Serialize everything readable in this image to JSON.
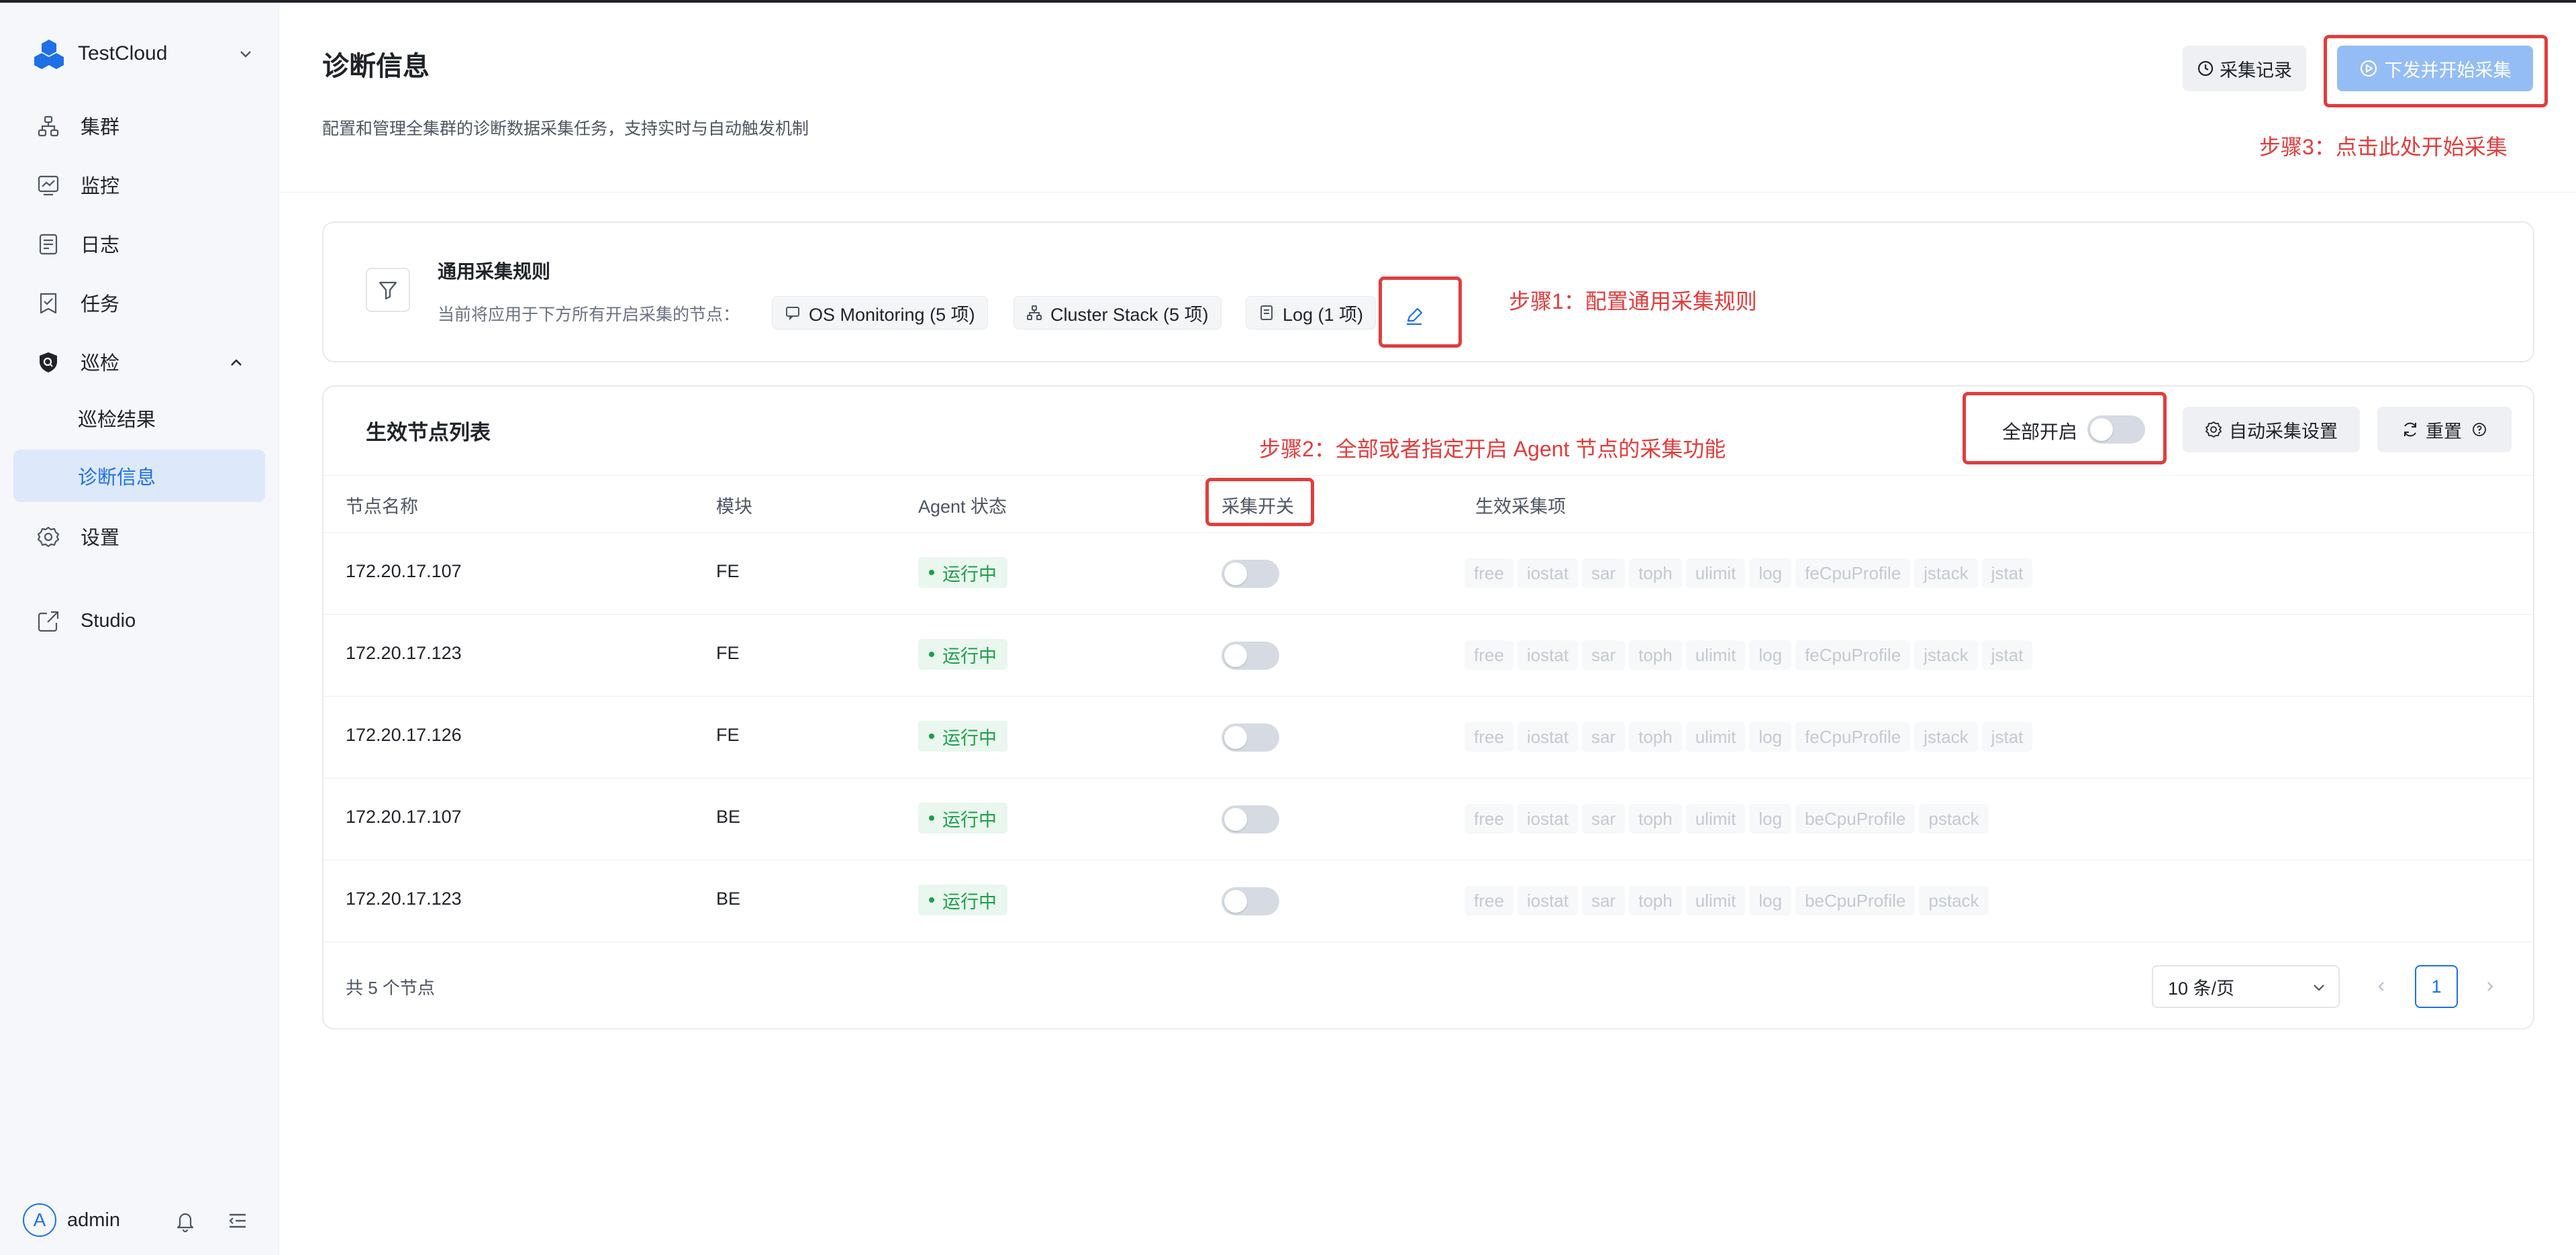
{
  "app": {
    "name": "TestCloud"
  },
  "sidebar": {
    "items": [
      {
        "label": "集群",
        "icon": "cluster-icon"
      },
      {
        "label": "监控",
        "icon": "monitor-icon"
      },
      {
        "label": "日志",
        "icon": "log-icon"
      },
      {
        "label": "任务",
        "icon": "task-icon"
      },
      {
        "label": "巡检",
        "icon": "shield-icon"
      },
      {
        "label": "设置",
        "icon": "gear-icon"
      },
      {
        "label": "Studio",
        "icon": "external-link-icon"
      }
    ],
    "sub_items": [
      {
        "label": "巡检结果"
      },
      {
        "label": "诊断信息",
        "active": true
      }
    ],
    "user": {
      "avatar": "A",
      "name": "admin"
    }
  },
  "header": {
    "title": "诊断信息",
    "description": "配置和管理全集群的诊断数据采集任务，支持实时与自动触发机制",
    "records_button": "采集记录",
    "start_button": "下发并开始采集"
  },
  "annotations": {
    "step1": "步骤1：配置通用采集规则",
    "step2": "步骤2：全部或者指定开启 Agent 节点的采集功能",
    "step3": "步骤3：点击此处开始采集",
    "color": "#e23c3c"
  },
  "rules": {
    "title": "通用采集规则",
    "description": "当前将应用于下方所有开启采集的节点：",
    "tags": [
      "OS Monitoring (5 项)",
      "Cluster Stack (5 项)",
      "Log (1 项)"
    ]
  },
  "node_list": {
    "title": "生效节点列表",
    "enable_all_label": "全部开启",
    "auto_button": "自动采集设置",
    "reset_button": "重置",
    "columns": [
      "节点名称",
      "模块",
      "Agent 状态",
      "采集开关",
      "生效采集项"
    ],
    "rows": [
      {
        "node": "172.20.17.107",
        "module": "FE",
        "status": "运行中",
        "items": [
          "free",
          "iostat",
          "sar",
          "toph",
          "ulimit",
          "log",
          "feCpuProfile",
          "jstack",
          "jstat"
        ]
      },
      {
        "node": "172.20.17.123",
        "module": "FE",
        "status": "运行中",
        "items": [
          "free",
          "iostat",
          "sar",
          "toph",
          "ulimit",
          "log",
          "feCpuProfile",
          "jstack",
          "jstat"
        ]
      },
      {
        "node": "172.20.17.126",
        "module": "FE",
        "status": "运行中",
        "items": [
          "free",
          "iostat",
          "sar",
          "toph",
          "ulimit",
          "log",
          "feCpuProfile",
          "jstack",
          "jstat"
        ]
      },
      {
        "node": "172.20.17.107",
        "module": "BE",
        "status": "运行中",
        "items": [
          "free",
          "iostat",
          "sar",
          "toph",
          "ulimit",
          "log",
          "beCpuProfile",
          "pstack"
        ]
      },
      {
        "node": "172.20.17.123",
        "module": "BE",
        "status": "运行中",
        "items": [
          "free",
          "iostat",
          "sar",
          "toph",
          "ulimit",
          "log",
          "beCpuProfile",
          "pstack"
        ]
      }
    ],
    "total": "共 5 个节点",
    "page_size": "10 条/页",
    "current_page": "1"
  },
  "colors": {
    "primary": "#1e6fe8",
    "primary_disabled": "#94bdf5",
    "status_green": "#1e9e4a"
  }
}
